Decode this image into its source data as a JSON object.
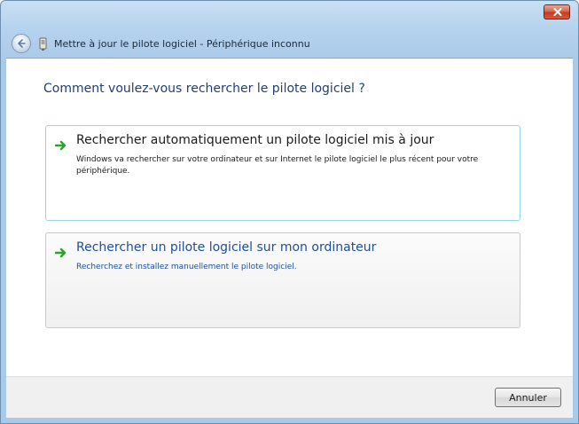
{
  "window": {
    "title": "Mettre à jour le pilote logiciel - Périphérique inconnu"
  },
  "icons": {
    "back": "back-arrow-icon",
    "device": "device-icon",
    "close": "close-icon",
    "option_arrow": "green-arrow-icon"
  },
  "main": {
    "heading": "Comment voulez-vous rechercher le pilote logiciel ?",
    "options": [
      {
        "title": "Rechercher automatiquement un pilote logiciel mis à jour",
        "description": "Windows va rechercher sur votre ordinateur et sur Internet le pilote logiciel le plus récent pour votre périphérique."
      },
      {
        "title": "Rechercher un pilote logiciel sur mon ordinateur",
        "description": "Recherchez et installez manuellement le pilote logiciel."
      }
    ]
  },
  "footer": {
    "cancel_label": "Annuler"
  },
  "colors": {
    "heading": "#1e3f7a",
    "link": "#1e4f9a",
    "arrow_green": "#2aa52a",
    "close_red": "#c23b22"
  }
}
